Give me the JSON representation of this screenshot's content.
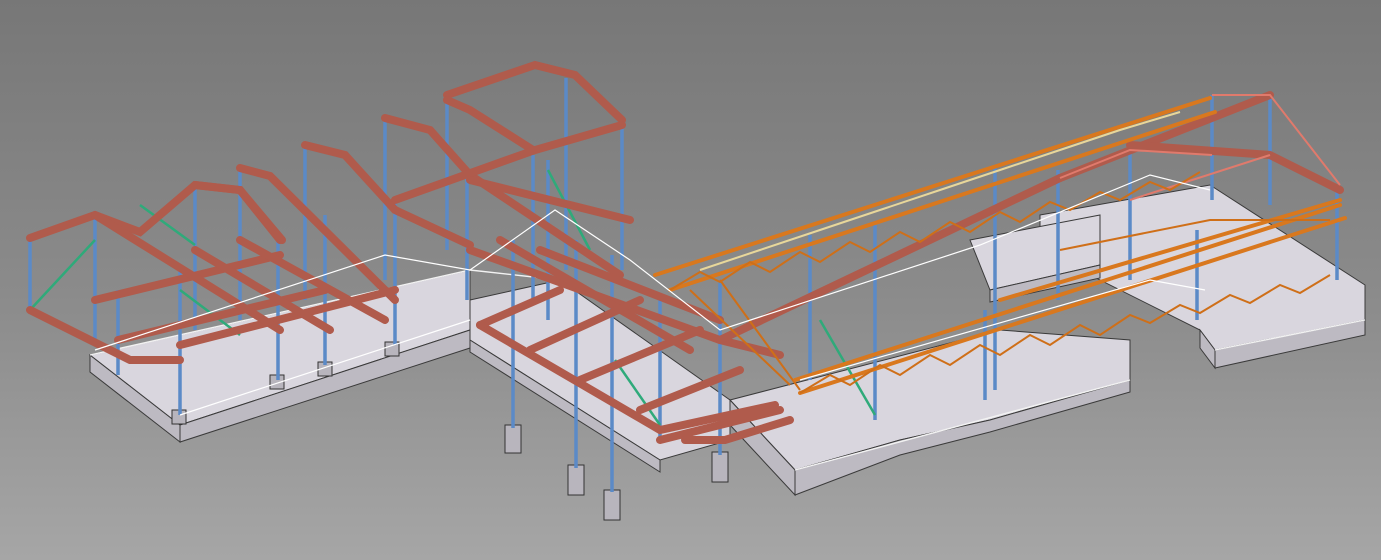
{
  "viewport": {
    "background_top": "#777777",
    "background_bottom": "#a6a6a6"
  },
  "colors": {
    "steel_beam": "#b05b4c",
    "column": "#5b8ac7",
    "bracing": "#2faa7a",
    "truss": "#d9781e",
    "foundation": "#d9d6de"
  }
}
